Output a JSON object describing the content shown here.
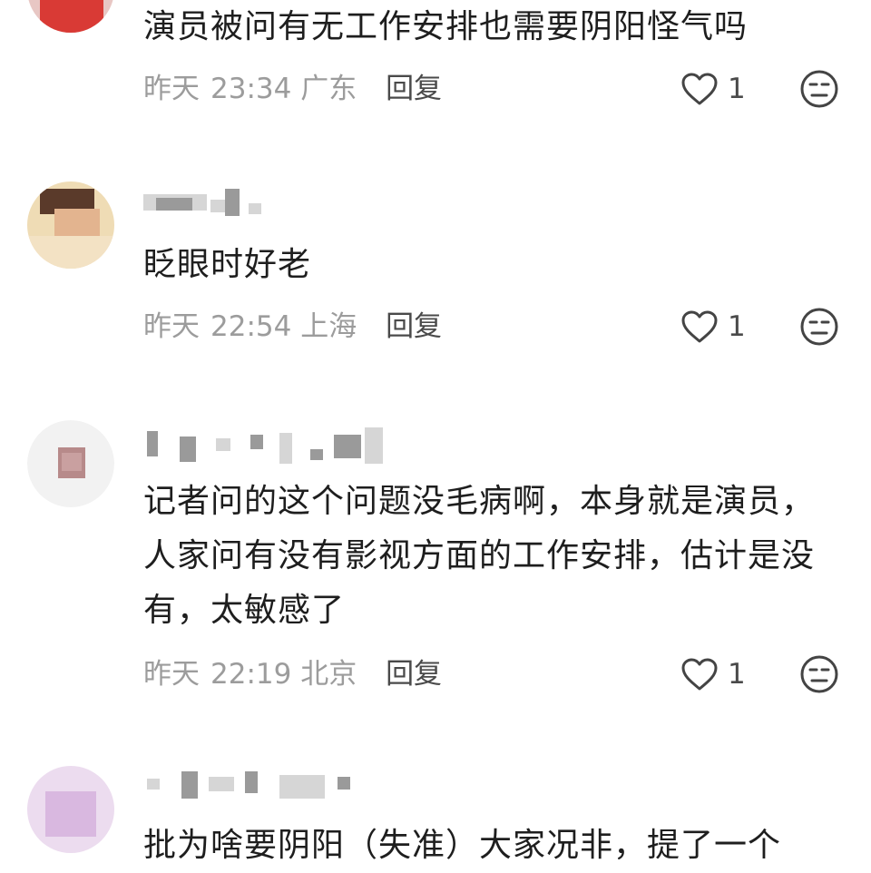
{
  "comments": [
    {
      "text": "演员被问有无工作安排也需要阴阳怪气吗",
      "date": "昨天",
      "time": "23:34",
      "location": "广东",
      "reply_label": "回复",
      "likes": "1"
    },
    {
      "text": "眨眼时好老",
      "date": "昨天",
      "time": "22:54",
      "location": "上海",
      "reply_label": "回复",
      "likes": "1"
    },
    {
      "text": "记者问的这个问题没毛病啊，本身就是演员，人家问有没有影视方面的工作安排，估计是没有，太敏感了",
      "date": "昨天",
      "time": "22:19",
      "location": "北京",
      "reply_label": "回复",
      "likes": "1"
    },
    {
      "text": "批为啥要阴阳（失准）大家况非，提了一个",
      "date": "",
      "time": "",
      "location": "",
      "reply_label": "",
      "likes": ""
    }
  ],
  "icons": {
    "like": "heart-outline-icon",
    "emoji": "neutral-face-icon"
  },
  "colors": {
    "text_primary": "#1e1e1e",
    "text_meta": "#9c9c9c",
    "reply_text": "#4a4a4a",
    "icon_stroke": "#444444"
  }
}
